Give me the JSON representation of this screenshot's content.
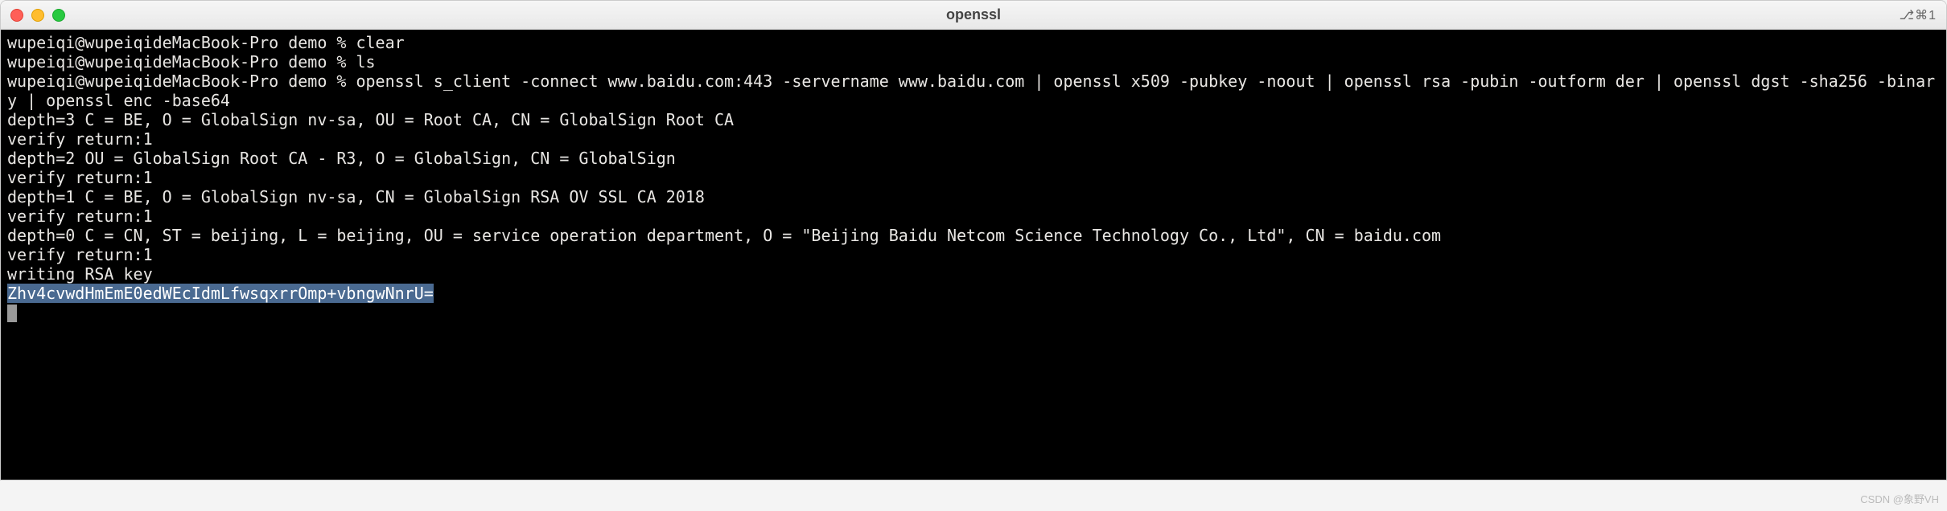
{
  "titlebar": {
    "title": "openssl",
    "right_indicator": "⎇⌘1"
  },
  "terminal": {
    "prompt": "wupeiqi@wupeiqidemMacBook-Pro demo % ",
    "lines": [
      "wupeiqi@wupeiqideMacBook-Pro demo % clear",
      "wupeiqi@wupeiqideMacBook-Pro demo % ls",
      "wupeiqi@wupeiqideMacBook-Pro demo % openssl s_client -connect www.baidu.com:443 -servername www.baidu.com | openssl x509 -pubkey -noout | openssl rsa -pubin -outform der | openssl dgst -sha256 -binary | openssl enc -base64",
      "depth=3 C = BE, O = GlobalSign nv-sa, OU = Root CA, CN = GlobalSign Root CA",
      "verify return:1",
      "depth=2 OU = GlobalSign Root CA - R3, O = GlobalSign, CN = GlobalSign",
      "verify return:1",
      "depth=1 C = BE, O = GlobalSign nv-sa, CN = GlobalSign RSA OV SSL CA 2018",
      "verify return:1",
      "depth=0 C = CN, ST = beijing, L = beijing, OU = service operation department, O = \"Beijing Baidu Netcom Science Technology Co., Ltd\", CN = baidu.com",
      "verify return:1",
      "writing RSA key"
    ],
    "selected_output": "Zhv4cvwdHmEmE0edWEcIdmLfwsqxrrOmp+vbngwNnrU="
  },
  "watermark": "CSDN @象野VH"
}
